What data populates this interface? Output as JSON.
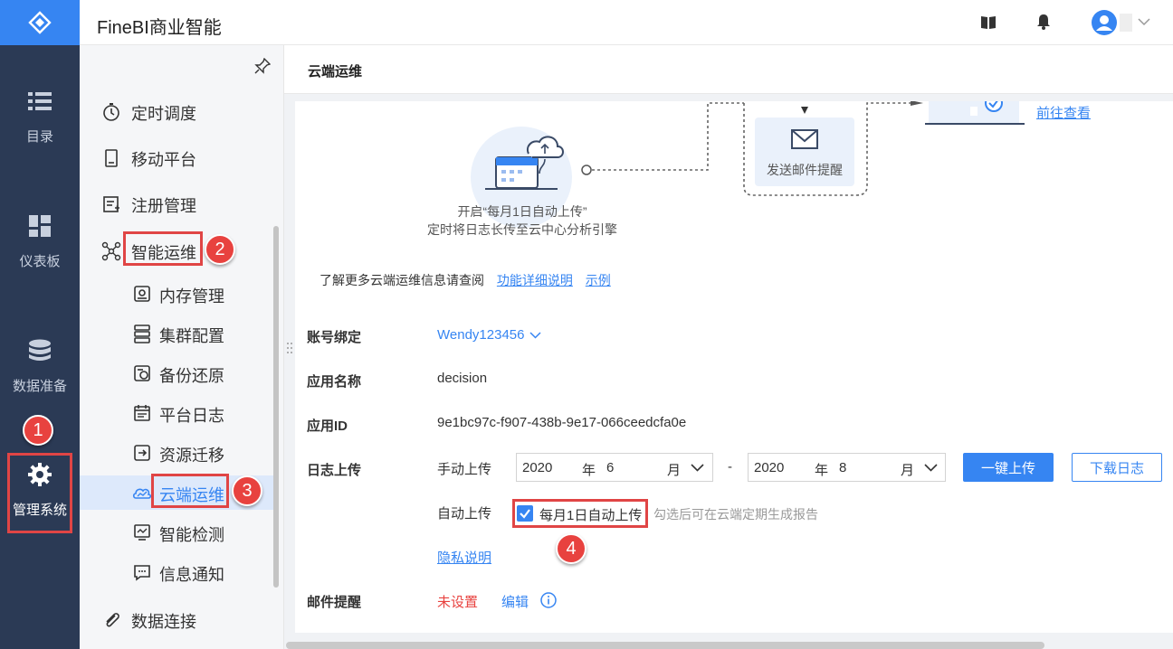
{
  "app": {
    "title": "FineBI商业智能"
  },
  "leftnav": {
    "items": [
      {
        "label": "目录",
        "icon": "list-icon"
      },
      {
        "label": "仪表板",
        "icon": "dashboard-icon"
      },
      {
        "label": "数据准备",
        "icon": "database-icon"
      },
      {
        "label": "管理系统",
        "icon": "gear-icon"
      }
    ]
  },
  "sidebar": {
    "menu": [
      {
        "label": "定时调度",
        "icon": "timer-icon"
      },
      {
        "label": "移动平台",
        "icon": "mobile-icon"
      },
      {
        "label": "注册管理",
        "icon": "register-icon"
      },
      {
        "label": "智能运维",
        "icon": "network-icon"
      }
    ],
    "submenu": [
      {
        "label": "内存管理",
        "icon": "memory-icon"
      },
      {
        "label": "集群配置",
        "icon": "cluster-icon"
      },
      {
        "label": "备份还原",
        "icon": "backup-icon"
      },
      {
        "label": "平台日志",
        "icon": "log-icon"
      },
      {
        "label": "资源迁移",
        "icon": "migrate-icon"
      },
      {
        "label": "云端运维",
        "icon": "cloud-ops-icon"
      },
      {
        "label": "智能检测",
        "icon": "detect-icon"
      },
      {
        "label": "信息通知",
        "icon": "message-icon"
      }
    ],
    "bottom": {
      "label": "数据连接",
      "icon": "paperclip-icon"
    }
  },
  "badges": {
    "b1": "1",
    "b2": "2",
    "b3": "3",
    "b4": "4"
  },
  "page": {
    "title": "云端运维",
    "flow": {
      "step1_line1": "开启“每月1日自动上传”",
      "step1_line2": "定时将日志长传至云中心分析引擎",
      "step2": "发送邮件提醒",
      "view_link": "前往查看"
    },
    "info_text": "了解更多云端运维信息请查阅",
    "info_link1": "功能详细说明",
    "info_link2": "示例",
    "account_label": "账号绑定",
    "account_value": "Wendy123456",
    "appname_label": "应用名称",
    "appname_value": "decision",
    "appid_label": "应用ID",
    "appid_value": "9e1bc97c-f907-438b-9e17-066ceedcfa0e",
    "log_label": "日志上传",
    "manual_label": "手动上传",
    "from_year": "2020",
    "from_month": "6",
    "to_year": "2020",
    "to_month": "8",
    "year_unit": "年",
    "month_unit": "月",
    "dash": "-",
    "upload_btn": "一键上传",
    "download_btn": "下载日志",
    "auto_label": "自动上传",
    "auto_checkbox": "每月1日自动上传",
    "auto_checked": true,
    "auto_hint": "勾选后可在云端定期生成报告",
    "privacy_link": "隐私说明",
    "mail_label": "邮件提醒",
    "mail_status": "未设置",
    "mail_edit": "编辑"
  },
  "colors": {
    "accent": "#3685f2",
    "nav_bg": "#2b3a55",
    "red": "#e8423f"
  }
}
